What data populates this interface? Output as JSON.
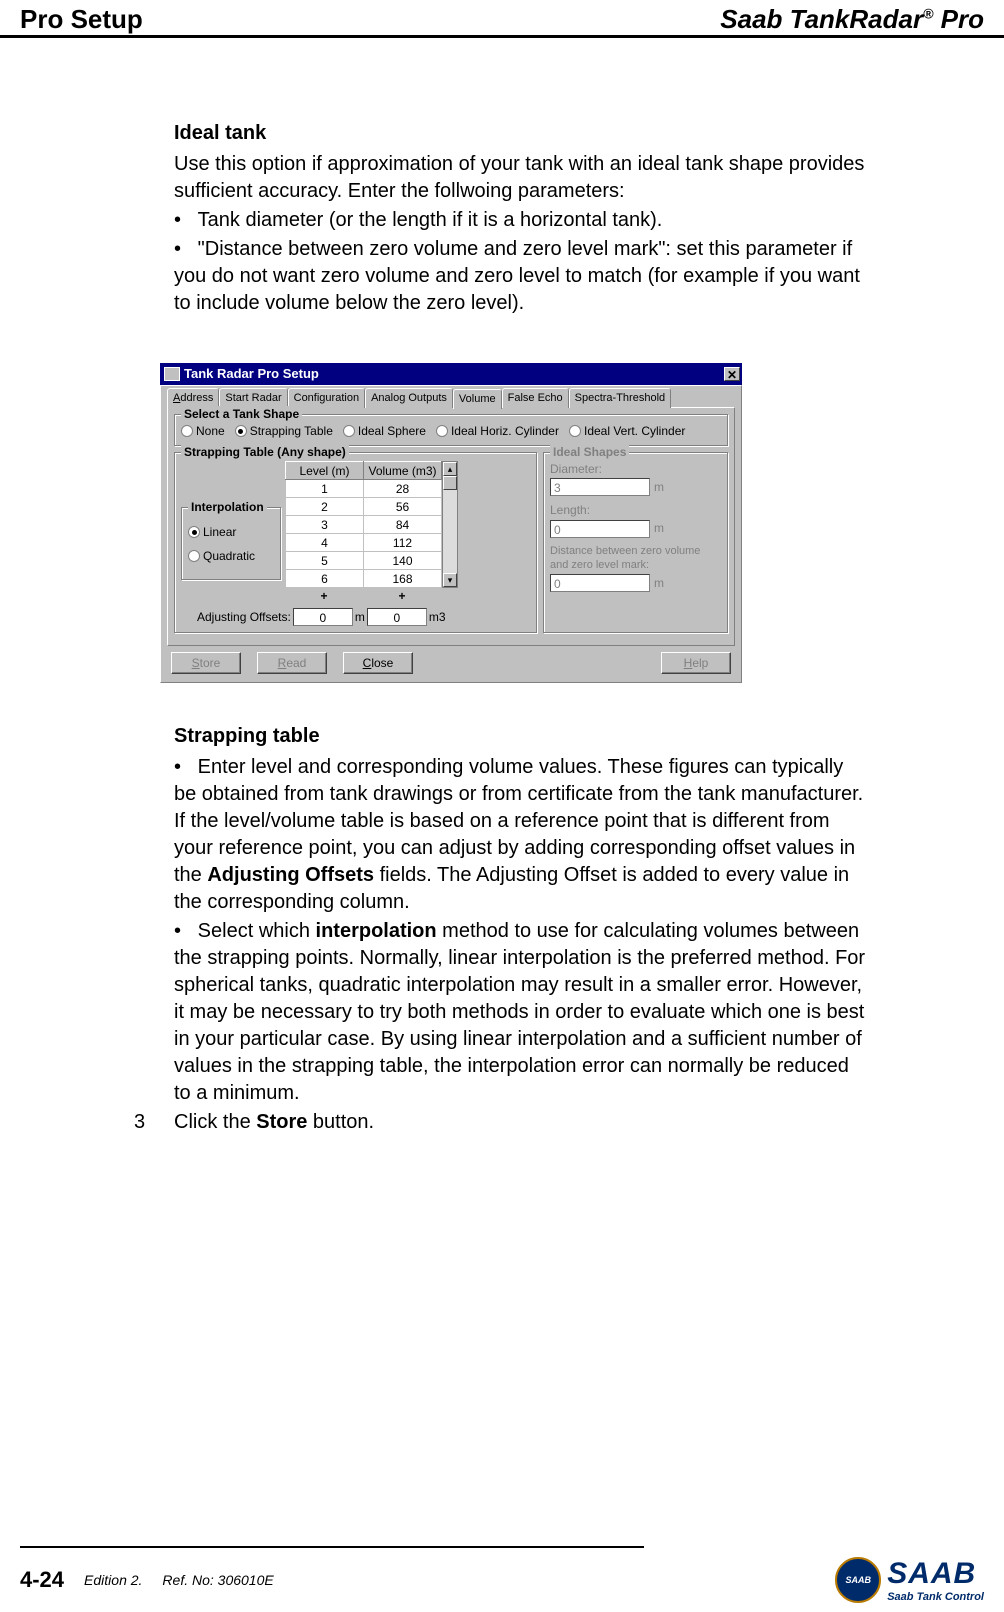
{
  "header": {
    "left": "Pro Setup",
    "right_brand": "Saab TankRadar",
    "right_suffix": " Pro",
    "reg": "®"
  },
  "section1": {
    "title": "Ideal tank",
    "intro": "Use this option if approximation of your tank with an ideal tank shape provides sufficient accuracy. Enter the follwoing parameters:",
    "b1": "Tank diameter (or the length if it is a horizontal tank).",
    "b2": "\"Distance between zero volume and zero level mark\": set this parameter if you do not want zero volume and zero level to match (for example if you want to include volume below the zero level)."
  },
  "dialog": {
    "title": "Tank Radar Pro Setup",
    "tabs": [
      "Address",
      "Start Radar",
      "Configuration",
      "Analog Outputs",
      "Volume",
      "False Echo",
      "Spectra-Threshold"
    ],
    "active_tab": 4,
    "shape_legend": "Select a Tank Shape",
    "shape_options": [
      "None",
      "Strapping Table",
      "Ideal Sphere",
      "Ideal Horiz. Cylinder",
      "Ideal Vert. Cylinder"
    ],
    "shape_selected": 1,
    "strap_legend": "Strapping Table  (Any shape)",
    "interp_legend": "Interpolation",
    "interp_options": [
      "Linear",
      "Quadratic"
    ],
    "interp_selected": 0,
    "table_head": [
      "Level (m)",
      "Volume (m3)"
    ],
    "table_rows": [
      [
        "1",
        "28"
      ],
      [
        "2",
        "56"
      ],
      [
        "3",
        "84"
      ],
      [
        "4",
        "112"
      ],
      [
        "5",
        "140"
      ],
      [
        "6",
        "168"
      ]
    ],
    "plus": "+",
    "offsets_label": "Adjusting Offsets:",
    "offset_level": "0",
    "offset_level_unit": "m",
    "offset_vol": "0",
    "offset_vol_unit": "m3",
    "ideal_legend": "Ideal Shapes",
    "diameter_label": "Diameter:",
    "diameter_val": "3",
    "length_label": "Length:",
    "length_val": "0",
    "dist_label": "Distance between zero volume and zero level mark:",
    "dist_val": "0",
    "unit_m": "m",
    "buttons": {
      "store": "Store",
      "read": "Read",
      "close": "Close",
      "help": "Help"
    }
  },
  "section2": {
    "title": "Strapping table",
    "p1a": "Enter level and corresponding volume values. These figures can typically be obtained from tank drawings or from certificate from the tank manufacturer. If the level/volume table is based on a reference point that is different from your reference point, you can adjust by adding corresponding offset values in the ",
    "p1b_bold": "Adjusting Offsets",
    "p1c": " fields. The Adjusting Offset is added to every value in the corresponding column.",
    "p2a": "Select which ",
    "p2b_bold": "interpolation",
    "p2c": " method to use for calculating vol­umes between the strapping points. Normally, linear interpolation is the preferred method. For spherical tanks, quadratic interpolation may result in a smaller error. However, it may be necessary to try both methods in order to evaluate which one is best in your particu­lar case. By using linear interpolation and a sufficient number of values in the strapping table, the interpolation error can normally be reduced to a minimum."
  },
  "step3": {
    "num": "3",
    "a": "Click the ",
    "bold": "Store",
    "b": " button."
  },
  "footer": {
    "page": "4-24",
    "edition": "Edition 2.",
    "ref": "Ref. No: 306010E",
    "logo_badge": "SAAB",
    "logo_text": "SAAB",
    "logo_sub": "Saab Tank Control"
  }
}
